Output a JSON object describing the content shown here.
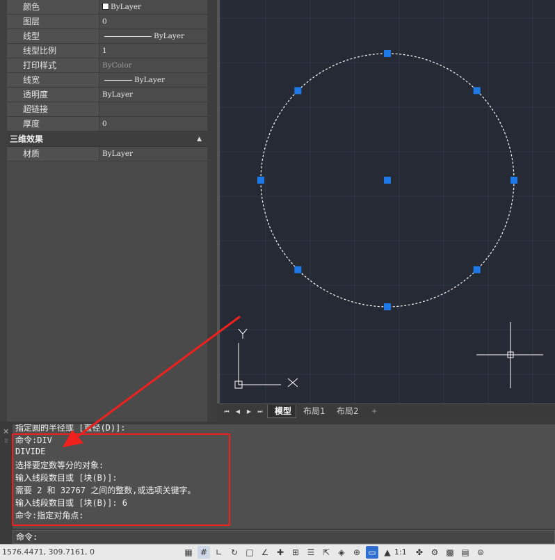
{
  "properties": {
    "rows": [
      {
        "name": "颜色",
        "value": "ByLayer",
        "kind": "swatch"
      },
      {
        "name": "图层",
        "value": "0",
        "kind": "text"
      },
      {
        "name": "线型",
        "value": "ByLayer",
        "kind": "line-long"
      },
      {
        "name": "线型比例",
        "value": "1",
        "kind": "text"
      },
      {
        "name": "打印样式",
        "value": "ByColor",
        "kind": "dim"
      },
      {
        "name": "线宽",
        "value": "ByLayer",
        "kind": "line-short"
      },
      {
        "name": "透明度",
        "value": "ByLayer",
        "kind": "text"
      },
      {
        "name": "超链接",
        "value": "",
        "kind": "text"
      },
      {
        "name": "厚度",
        "value": "0",
        "kind": "text"
      }
    ],
    "section": {
      "title": "三维效果",
      "collapse_icon": "▲"
    },
    "section_rows": [
      {
        "name": "材质",
        "value": "ByLayer",
        "kind": "text"
      }
    ]
  },
  "viewport": {
    "background": "#252a35",
    "ucs": {
      "y_label": "Y"
    }
  },
  "layout_tabs": {
    "nav": [
      "⏮",
      "◀",
      "▶",
      "⏭"
    ],
    "tabs": [
      "模型",
      "布局1",
      "布局2"
    ],
    "active_tab": "模型",
    "add": "+"
  },
  "command": {
    "history": [
      "指定圆的半径或 [直径(D)]:",
      "命令:DIV",
      "DIVIDE",
      "选择要定数等分的对象:",
      "输入线段数目或 [块(B)]:",
      "需要 2 和 32767 之间的整数,或选项关键字。",
      "输入线段数目或 [块(B)]: 6",
      "命令:指定对角点:"
    ],
    "prompt": "命令:",
    "close_icon": "✕",
    "grip_icon": "⠿"
  },
  "status": {
    "coords": "1576.4471, 309.7161, 0",
    "scale": "1:1",
    "accent": "#2f6fd1"
  },
  "annotation": {
    "color": "#f0201c"
  }
}
